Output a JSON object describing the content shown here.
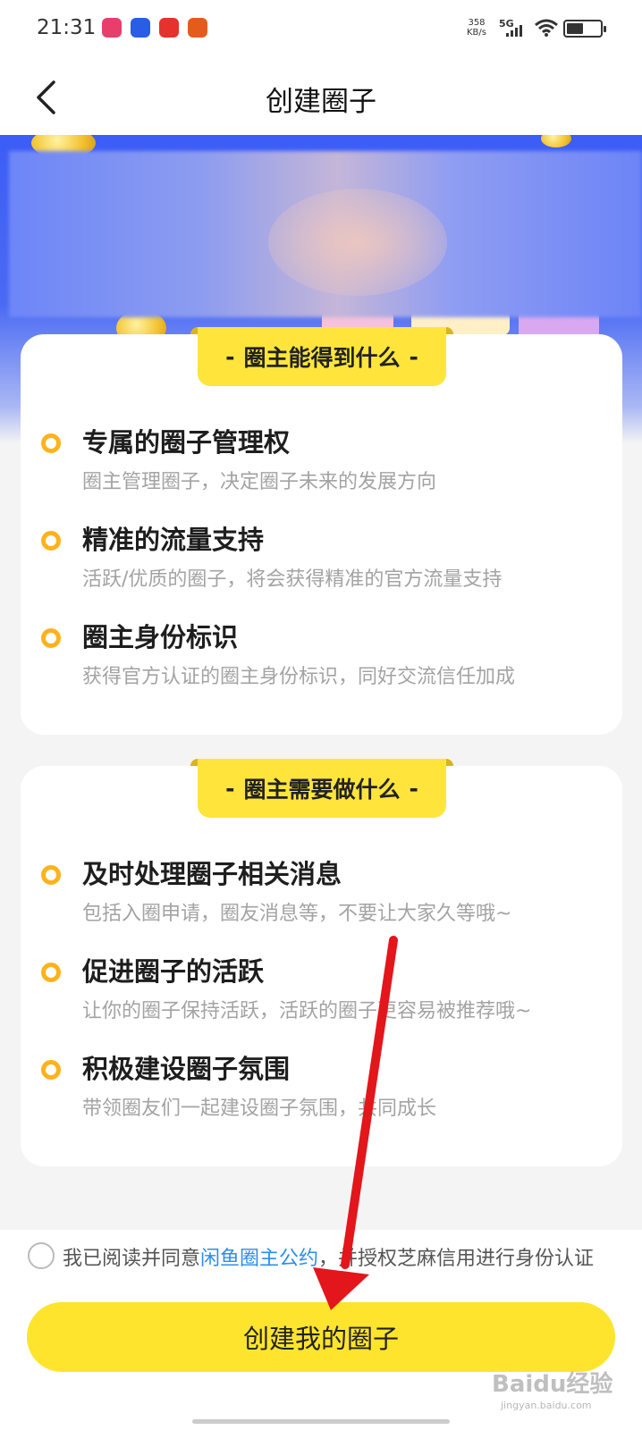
{
  "status_bar": {
    "time": "21:31",
    "net_speed_value": "358",
    "net_speed_unit": "KB/s",
    "network": "5G",
    "battery_level": 0.5,
    "notif_icons": [
      "weibo-icon",
      "baidu-paw-icon",
      "netease-music-icon",
      "taobao-icon"
    ],
    "notif_colors": [
      "#e83e6c",
      "#2a5ce8",
      "#e5322d",
      "#e65b1c"
    ]
  },
  "nav": {
    "title": "创建圈子",
    "back_icon": "chevron-left-icon"
  },
  "sections": [
    {
      "header_dash": "-",
      "header": "圈主能得到什么",
      "items": [
        {
          "title": "专属的圈子管理权",
          "desc": "圈主管理圈子，决定圈子未来的发展方向"
        },
        {
          "title": "精准的流量支持",
          "desc": "活跃/优质的圈子，将会获得精准的官方流量支持"
        },
        {
          "title": "圈主身份标识",
          "desc": "获得官方认证的圈主身份标识，同好交流信任加成"
        }
      ]
    },
    {
      "header_dash": "-",
      "header": "圈主需要做什么",
      "items": [
        {
          "title": "及时处理圈子相关消息",
          "desc": "包括入圈申请，圈友消息等，不要让大家久等哦~"
        },
        {
          "title": "促进圈子的活跃",
          "desc": "让你的圈子保持活跃，活跃的圈子更容易被推荐哦~"
        },
        {
          "title": "积极建设圈子氛围",
          "desc": "带领圈友们一起建设圈子氛围，共同成长"
        }
      ]
    }
  ],
  "agreement": {
    "prefix": "我已阅读并同意",
    "link": "闲鱼圈主公约",
    "suffix": "，并授权芝麻信用进行身份认证"
  },
  "create_button": "创建我的圈子",
  "watermark": {
    "main": "Baidu经验",
    "sub": "jingyan.baidu.com"
  },
  "colors": {
    "accent_yellow": "#ffe42e",
    "bullet_orange": "#ffb21b",
    "link_blue": "#2b8cf0",
    "banner_blue": "#3c5df6",
    "annotation_arrow": "#e3161b"
  }
}
